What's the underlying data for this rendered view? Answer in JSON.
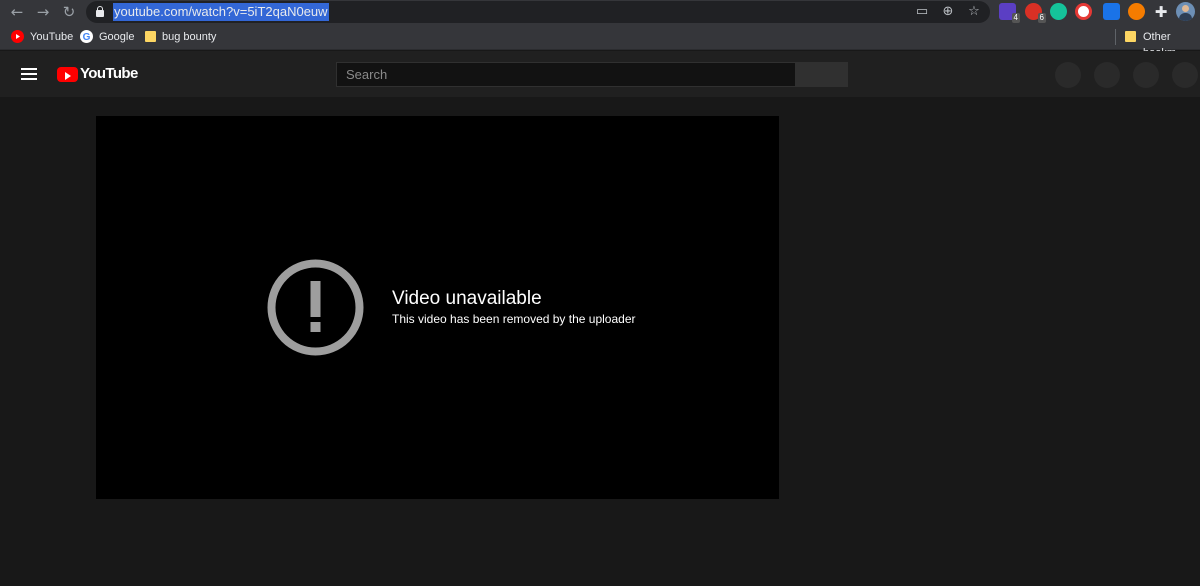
{
  "browser": {
    "url": "youtube.com/watch?v=5iT2qaN0euw",
    "extensions": [
      {
        "name": "extension-icon-1",
        "badge": "4",
        "color": "#5b3fc4"
      },
      {
        "name": "extension-icon-2",
        "badge": "6",
        "color": "#d93025"
      },
      {
        "name": "grammarly-icon",
        "badge": "",
        "color": "#15c39a"
      },
      {
        "name": "extension-icon-4",
        "badge": "",
        "color": "#e53935"
      },
      {
        "name": "extension-icon-5",
        "badge": "",
        "color": "#1a73e8"
      },
      {
        "name": "extension-icon-6",
        "badge": "",
        "color": "#f57c00"
      }
    ]
  },
  "bookmarks": {
    "items": [
      {
        "label": "YouTube",
        "icon": "youtube-icon"
      },
      {
        "label": "Google",
        "icon": "google-icon"
      },
      {
        "label": "bug bounty",
        "icon": "folder-icon"
      }
    ],
    "other": "Other bookm"
  },
  "youtube": {
    "logo_text": "YouTube",
    "search_placeholder": "Search"
  },
  "player": {
    "error_title": "Video unavailable",
    "error_message": "This video has been removed by the uploader"
  },
  "colors": {
    "accent": "#ff0000",
    "url_selection": "#3367d6",
    "page_bg": "#181818"
  }
}
